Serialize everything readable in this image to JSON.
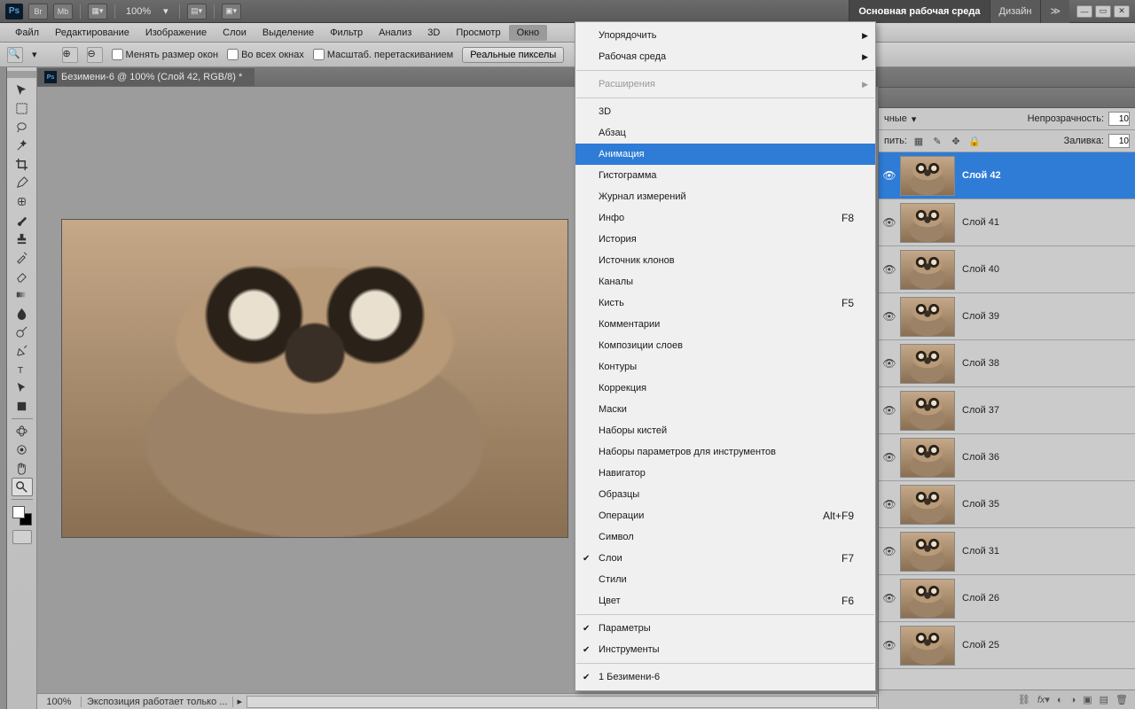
{
  "appbar": {
    "zoom": "100%",
    "workspace_active": "Основная рабочая среда",
    "workspace_other": "Дизайн",
    "chevrons": "≫"
  },
  "menu": [
    "Файл",
    "Редактирование",
    "Изображение",
    "Слои",
    "Выделение",
    "Фильтр",
    "Анализ",
    "3D",
    "Просмотр",
    "Окно"
  ],
  "menu_open_index": 9,
  "optbar": {
    "resize_windows": "Менять размер окон",
    "all_windows": "Во всех окнах",
    "scrubby": "Масштаб. перетаскиванием",
    "actual_px": "Реальные пикселы"
  },
  "doc": {
    "title": "Безимени-6 @ 100% (Слой 42, RGB/8) *"
  },
  "status": {
    "zoom": "100%",
    "info": "Экспозиция работает только ..."
  },
  "layers_panel": {
    "blend_label_suffix": "чные",
    "opacity_label": "Непрозрачность:",
    "opacity_val": "10",
    "lock_label": "пить:",
    "fill_label": "Заливка:",
    "fill_val": "10"
  },
  "layers": [
    {
      "name": "Слой 42",
      "sel": true
    },
    {
      "name": "Слой 41"
    },
    {
      "name": "Слой 40"
    },
    {
      "name": "Слой 39"
    },
    {
      "name": "Слой 38"
    },
    {
      "name": "Слой 37"
    },
    {
      "name": "Слой 36"
    },
    {
      "name": "Слой 35"
    },
    {
      "name": "Слой 31"
    },
    {
      "name": "Слой 26"
    },
    {
      "name": "Слой 25"
    }
  ],
  "dropdown": [
    {
      "t": "item",
      "label": "Упорядочить",
      "sub": true
    },
    {
      "t": "item",
      "label": "Рабочая среда",
      "sub": true
    },
    {
      "t": "sep"
    },
    {
      "t": "item",
      "label": "Расширения",
      "sub": true,
      "dis": true
    },
    {
      "t": "sep"
    },
    {
      "t": "item",
      "label": "3D"
    },
    {
      "t": "item",
      "label": "Абзац"
    },
    {
      "t": "item",
      "label": "Анимация",
      "hl": true
    },
    {
      "t": "item",
      "label": "Гистограмма"
    },
    {
      "t": "item",
      "label": "Журнал измерений"
    },
    {
      "t": "item",
      "label": "Инфо",
      "shc": "F8"
    },
    {
      "t": "item",
      "label": "История"
    },
    {
      "t": "item",
      "label": "Источник клонов"
    },
    {
      "t": "item",
      "label": "Каналы"
    },
    {
      "t": "item",
      "label": "Кисть",
      "shc": "F5"
    },
    {
      "t": "item",
      "label": "Комментарии"
    },
    {
      "t": "item",
      "label": "Композиции слоев"
    },
    {
      "t": "item",
      "label": "Контуры"
    },
    {
      "t": "item",
      "label": "Коррекция"
    },
    {
      "t": "item",
      "label": "Маски"
    },
    {
      "t": "item",
      "label": "Наборы кистей"
    },
    {
      "t": "item",
      "label": "Наборы параметров для инструментов"
    },
    {
      "t": "item",
      "label": "Навигатор"
    },
    {
      "t": "item",
      "label": "Образцы"
    },
    {
      "t": "item",
      "label": "Операции",
      "shc": "Alt+F9"
    },
    {
      "t": "item",
      "label": "Символ"
    },
    {
      "t": "item",
      "label": "Слои",
      "chk": true,
      "shc": "F7"
    },
    {
      "t": "item",
      "label": "Стили"
    },
    {
      "t": "item",
      "label": "Цвет",
      "shc": "F6"
    },
    {
      "t": "sep"
    },
    {
      "t": "item",
      "label": "Параметры",
      "chk": true
    },
    {
      "t": "item",
      "label": "Инструменты",
      "chk": true
    },
    {
      "t": "sep"
    },
    {
      "t": "item",
      "label": "1 Безимени-6",
      "chk": true
    }
  ]
}
